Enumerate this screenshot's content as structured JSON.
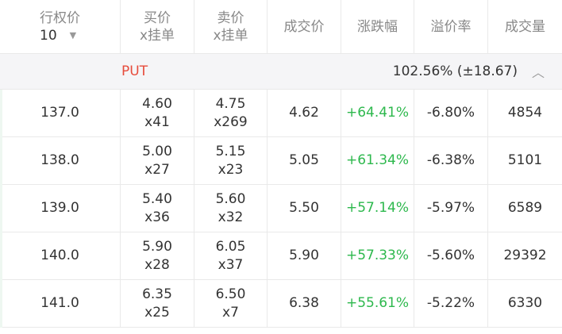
{
  "header": {
    "strike_title": "行权价",
    "strike_value": "10",
    "bid_title": "买价",
    "bid_sub": "x挂单",
    "ask_title": "卖价",
    "ask_sub": "x挂单",
    "last_title": "成交价",
    "change_title": "涨跌幅",
    "premium_title": "溢价率",
    "volume_title": "成交量"
  },
  "section": {
    "label": "PUT",
    "iv": "102.56% (±18.67)"
  },
  "rows": [
    {
      "strike": "137.0",
      "bid": "4.60",
      "bid_size": "x41",
      "ask": "4.75",
      "ask_size": "x269",
      "last": "4.62",
      "change": "+64.41%",
      "premium": "-6.80%",
      "volume": "4854"
    },
    {
      "strike": "138.0",
      "bid": "5.00",
      "bid_size": "x27",
      "ask": "5.15",
      "ask_size": "x23",
      "last": "5.05",
      "change": "+61.34%",
      "premium": "-6.38%",
      "volume": "5101"
    },
    {
      "strike": "139.0",
      "bid": "5.40",
      "bid_size": "x36",
      "ask": "5.60",
      "ask_size": "x32",
      "last": "5.50",
      "change": "+57.14%",
      "premium": "-5.97%",
      "volume": "6589"
    },
    {
      "strike": "140.0",
      "bid": "5.90",
      "bid_size": "x28",
      "ask": "6.05",
      "ask_size": "x37",
      "last": "5.90",
      "change": "+57.33%",
      "premium": "-5.60%",
      "volume": "29392"
    },
    {
      "strike": "141.0",
      "bid": "6.35",
      "bid_size": "x25",
      "ask": "6.50",
      "ask_size": "x7",
      "last": "6.38",
      "change": "+55.61%",
      "premium": "-5.22%",
      "volume": "6330"
    }
  ],
  "colors": {
    "up": "#2db84d",
    "put": "#e74c3c",
    "section_bg": "#f5f5f7"
  },
  "icons": {
    "strike_dropdown": "chevron-down-icon",
    "collapse": "chevron-up-icon"
  }
}
